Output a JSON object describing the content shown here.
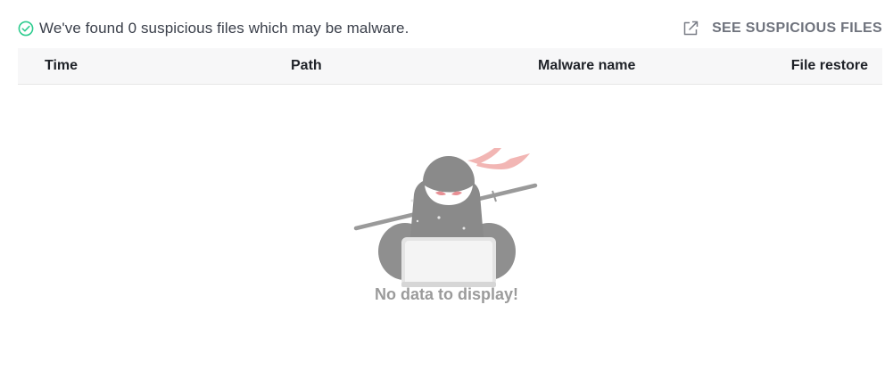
{
  "status": {
    "icon": "check-circle-icon",
    "text": "We've found 0 suspicious files which may be malware.",
    "color": "#2ecc8f"
  },
  "action": {
    "icon": "external-link-icon",
    "label": "SEE SUSPICIOUS FILES"
  },
  "table": {
    "columns": [
      "Time",
      "Path",
      "Malware name",
      "File restore"
    ],
    "rows": []
  },
  "empty_state": {
    "illustration": "ninja-laptop-illustration",
    "text": "No data to display!"
  }
}
